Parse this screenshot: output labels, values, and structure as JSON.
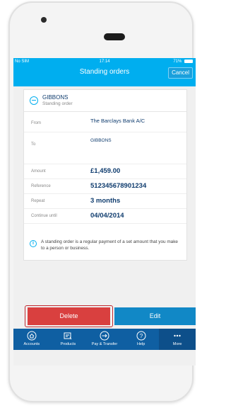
{
  "status": {
    "carrier": "No SIM",
    "time": "17:14",
    "battery": "71%"
  },
  "nav": {
    "title": "Standing orders",
    "cancel_label": "Cancel"
  },
  "payee": {
    "name": "GIBBONS",
    "type": "Standing order"
  },
  "details": [
    {
      "label": "From",
      "value": "The Barclays Bank A/C"
    },
    {
      "label": "To",
      "value": "GIBBONS"
    },
    {
      "label": "Amount",
      "value": "£1,459.00"
    },
    {
      "label": "Reference",
      "value": "512345678901234"
    },
    {
      "label": "Repeat",
      "value": "3 months"
    },
    {
      "label": "Continue until",
      "value": "04/04/2014"
    }
  ],
  "info": {
    "text": "A standing order is a regular payment of a set amount that you make to a person or business."
  },
  "actions": {
    "delete_label": "Delete",
    "edit_label": "Edit"
  },
  "tabs": [
    {
      "label": "Accounts",
      "icon": "house-icon"
    },
    {
      "label": "Products",
      "icon": "products-icon"
    },
    {
      "label": "Pay & Transfer",
      "icon": "transfer-icon"
    },
    {
      "label": "Help",
      "icon": "help-icon"
    },
    {
      "label": "More",
      "icon": "more-icon"
    }
  ],
  "colors": {
    "primary": "#00aeef",
    "tab_bar": "#0f5fa2",
    "delete": "#d9403f",
    "edit": "#1188c6",
    "text_value": "#0f3c6e"
  }
}
